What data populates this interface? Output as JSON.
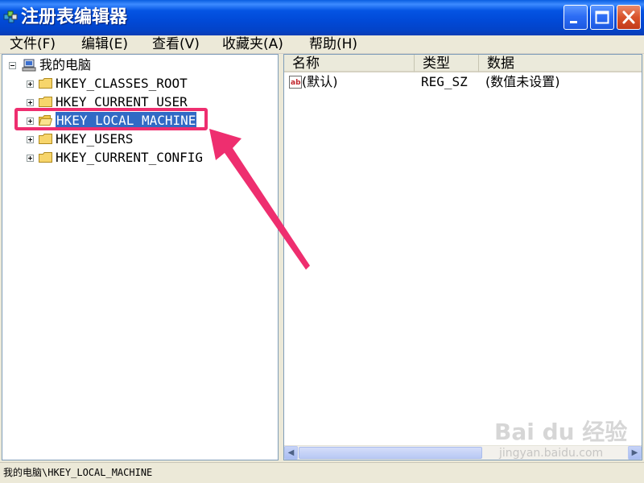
{
  "window": {
    "title": "注册表编辑器",
    "colors": {
      "titlebar": "#0454e3",
      "close_button": "#d9532a",
      "selection": "#316ac5",
      "highlight_box": "#ee2e6f"
    }
  },
  "menu": [
    {
      "label": "文件(F)"
    },
    {
      "label": "编辑(E)"
    },
    {
      "label": "查看(V)"
    },
    {
      "label": "收藏夹(A)"
    },
    {
      "label": "帮助(H)"
    }
  ],
  "tree": {
    "root": {
      "label": "我的电脑",
      "icon": "computer-icon",
      "expander": "minus"
    },
    "children": [
      {
        "label": "HKEY_CLASSES_ROOT",
        "icon": "folder-icon",
        "expander": "plus"
      },
      {
        "label": "HKEY_CURRENT_USER",
        "icon": "folder-icon",
        "expander": "plus"
      },
      {
        "label": "HKEY_LOCAL_MACHINE",
        "icon": "folder-open-icon",
        "expander": "plus",
        "selected": true
      },
      {
        "label": "HKEY_USERS",
        "icon": "folder-icon",
        "expander": "plus"
      },
      {
        "label": "HKEY_CURRENT_CONFIG",
        "icon": "folder-icon",
        "expander": "plus"
      }
    ]
  },
  "list": {
    "columns": [
      "名称",
      "类型",
      "数据"
    ],
    "rows": [
      {
        "name": "(默认)",
        "type": "REG_SZ",
        "data": "(数值未设置)",
        "icon": "string-value-icon"
      }
    ]
  },
  "status": {
    "path": "我的电脑\\HKEY_LOCAL_MACHINE"
  },
  "watermark": {
    "line1": "Bai du 经验",
    "line2": "jingyan.baidu.com"
  }
}
